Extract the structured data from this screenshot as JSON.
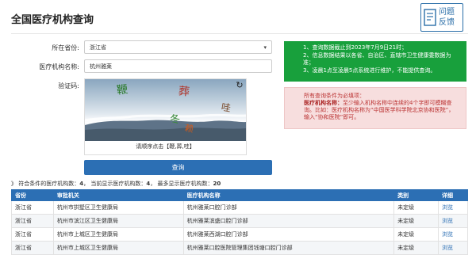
{
  "header": {
    "title": "全国医疗机构查询",
    "feedback_line1": "问题",
    "feedback_line2": "反馈"
  },
  "form": {
    "province_label": "所在省份:",
    "province_value": "浙江省",
    "name_label": "医疗机构名称:",
    "name_value": "杭州雅莱",
    "captcha_label": "验证码:",
    "captcha_chars": [
      "鞭",
      "葬",
      "哇",
      "冬",
      "赖"
    ],
    "captcha_hint": "请顺序点击【鞭,葬,哇】",
    "submit_label": "查询"
  },
  "notice_green": {
    "line1": "1、查询数据截止到2023年7月9日21时；",
    "line2": "2、信息数据结果以各省、自治区、直辖市卫生健康委数据为准；",
    "line3": "3、凌晨1点至凌晨5点系统进行维护，不能提供查询。"
  },
  "notice_red": {
    "line1": "所有查询条件为必填项：",
    "line2_label": "医疗机构名称：",
    "line2": "至少输入机构名称中连续的4个字即可模糊查询。比如：医疗机构名称为“中国医学科学院北京协和医院”，输入“协和医院”即可。"
  },
  "summary": {
    "prefix": "》 符合条件的医疗机构数：",
    "match_count": "4",
    "shown_label": "， 当前显示医疗机构数：",
    "shown_count": "4",
    "max_label": "， 最多显示医疗机构数：",
    "max_count": "20"
  },
  "table": {
    "headers": [
      "省份",
      "审批机关",
      "医疗机构名称",
      "类别",
      "详细"
    ],
    "rows": [
      [
        "浙江省",
        "杭州市拱墅区卫生健康局",
        "杭州雅莱口腔门诊部",
        "未定级",
        "浏览"
      ],
      [
        "浙江省",
        "杭州市滨江区卫生健康局",
        "杭州雅莱滨盛口腔门诊部",
        "未定级",
        "浏览"
      ],
      [
        "浙江省",
        "杭州市上城区卫生健康局",
        "杭州雅莱西湖口腔门诊部",
        "未定级",
        "浏览"
      ],
      [
        "浙江省",
        "杭州市上城区卫生健康局",
        "杭州雅莱口腔医院管理集团钱塘口腔门诊部",
        "未定级",
        "浏览"
      ]
    ]
  },
  "colors": {
    "primary": "#2c6fb4",
    "notice_green": "#18a03c",
    "notice_red_bg": "#f7dede"
  }
}
